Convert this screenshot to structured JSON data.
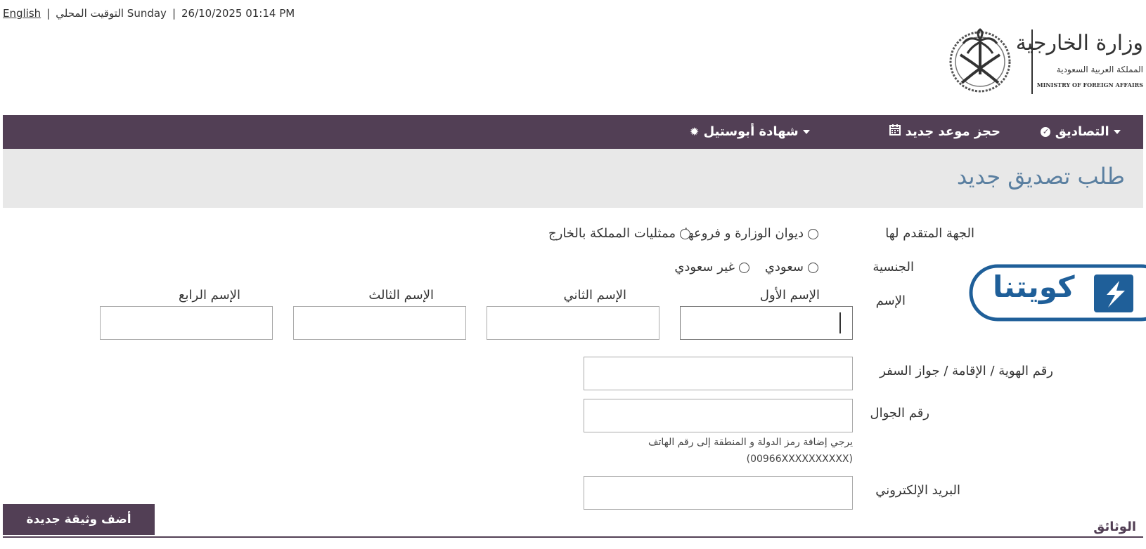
{
  "topbar": {
    "language_link": "English",
    "local_time_label": "التوقيت المحلي",
    "day": "Sunday",
    "datetime": "26/10/2025 01:14 PM"
  },
  "logo": {
    "arabic_title": "وزارة الخارجية",
    "arabic_subtitle": "المملكة العربية السعودية",
    "english_subtitle": "MINISTRY OF FOREIGN AFFAIRS"
  },
  "nav": {
    "attestations": "التصاديق",
    "book_appointment": "حجز موعد جديد",
    "apostille": "شهادة أبوستيل"
  },
  "page_title": "طلب تصديق جديد",
  "form": {
    "authority_label": "الجهة المتقدم لها",
    "authority_options": [
      "ديوان الوزارة و فروعها",
      "ممثليات المملكة بالخارج"
    ],
    "nationality_label": "الجنسية",
    "nationality_options": [
      "سعودي",
      "غير سعودي"
    ],
    "name_label": "الإسم",
    "name_parts": [
      "الإسم الأول",
      "الإسم الثاني",
      "الإسم الثالث",
      "الإسم الرابع"
    ],
    "id_label": "رقم الهوية / الإقامة / جواز السفر",
    "mobile_label": "رقم الجوال",
    "mobile_hint_1": "يرجي إضافة رمز الدولة و المنطقة إلى رقم الهاتف",
    "mobile_hint_2": "(00966XXXXXXXXXX)",
    "email_label": "البريد الإلكتروني"
  },
  "add_document_button": "أضف وثيقة جديدة",
  "documents_heading": "الوثائق",
  "watermark_text": "كويتنا",
  "colors": {
    "nav_bg": "#523f55",
    "title_blue": "#5a7fa0",
    "band_bg": "#e8e8e8",
    "watermark_blue": "#1f5f99"
  }
}
